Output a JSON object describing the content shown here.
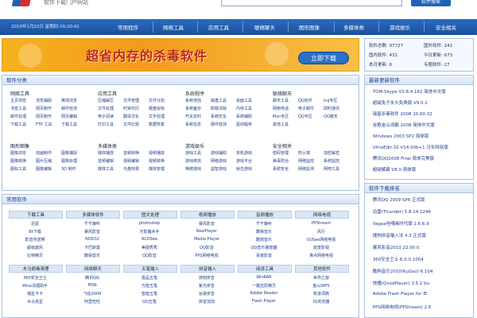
{
  "header": {
    "site_sub": "软件下载门户网站",
    "search_btn": "软件搜索"
  },
  "nav": {
    "date": "2010年1月22日 星期四 09:20:42",
    "items": [
      "常用程序",
      "网络工具",
      "应用工具",
      "联络聊天",
      "图形图像",
      "多媒体类",
      "游戏娱乐",
      "安全相关"
    ]
  },
  "banner": {
    "text": "超省内存的杀毒软件",
    "button": "立即下载"
  },
  "stats": {
    "line1a": "软件总数: 97727",
    "line1b": "国外软件: 241",
    "line2a": "国内软件: 431",
    "line2b": "今日更新: 673",
    "line3a": "本月更新: 6",
    "line3b": "专题软件: 27"
  },
  "categories": {
    "head": "软件分类",
    "groups": [
      {
        "title": "网络工具",
        "items": [
          "主页浏览",
          "浏览辅助",
          "离线浏览",
          "书签工具",
          "网页制作",
          "邮件检测",
          "邮件处理",
          "网页制作",
          "网页编辑",
          "下载工具",
          "FTP 工具",
          "下载工具"
        ]
      },
      {
        "title": "应用工具",
        "items": [
          "压缩解压",
          "文件管理",
          "文件分割",
          "文件处理",
          "时钟日历",
          "键盘鼠标",
          "电子阅读",
          "翻译汉化",
          "文字处理",
          "打印工具",
          "文件比较",
          "数据恢复"
        ]
      },
      {
        "title": "系统程序",
        "items": [
          "系统增强",
          "磁盘工具",
          "桌面工具",
          "系统备份",
          "卸载清除",
          "内存工具",
          "开关定时",
          "系统优化",
          "系统辅助",
          "系统信息",
          "硬件检测",
          "驱动程序"
        ]
      },
      {
        "title": "联络聊天",
        "items": [
          "聊天工具",
          "QQ软件",
          "Icq专区",
          "网络电话",
          "电子邮件",
          "即时通讯",
          "Msn专区",
          "QQ专区",
          "QQ聊天",
          "其他工具",
          "",
          ""
        ]
      },
      {
        "title": "图形图像",
        "items": [
          "图像浏览",
          "动画制作",
          "图像捕捉",
          "图像转换",
          "图片压缩",
          "图像处理",
          "图标工具",
          "图像编辑",
          "3D 制作"
        ]
      },
      {
        "title": "多媒体类",
        "items": [
          "媒体播放",
          "音频转换",
          "视频播放",
          "音频编辑",
          "视频编辑",
          "视频转换",
          "媒体工具",
          "光盘刻录",
          "媒体管理"
        ]
      },
      {
        "title": "游戏娱乐",
        "items": [
          "游戏工具",
          "游戏辅助",
          "单机游戏",
          "游戏修改",
          "网络游戏",
          "游戏平台",
          "棋牌游戏",
          "益智游戏",
          "射击游戏"
        ]
      },
      {
        "title": "安全相关",
        "items": [
          "密码管理",
          "防火墙",
          "加密解密",
          "病毒防治",
          "网络监控",
          "系统监控",
          "系统安全",
          "网络监测",
          "网吧工具"
        ]
      }
    ]
  },
  "common": {
    "head": "常用软件",
    "columns": [
      {
        "title": "下载工具",
        "items": [
          "迅雷",
          "Bt下载",
          "影音传送带",
          "超级旋风",
          "比特精灵"
        ]
      },
      {
        "title": "多媒体软件",
        "items": [
          "千千静听",
          "暴风影音",
          "NOD32",
          "卡巴斯基",
          "酷我音乐"
        ]
      },
      {
        "title": "图文处理",
        "items": [
          "photoshop",
          "光影魔术手",
          "ACDSee",
          "美图秀秀",
          "QQ影音"
        ]
      },
      {
        "title": "视频播放",
        "items": [
          "暴风影音",
          "RealPlayer",
          "Media Player",
          "QQ影音",
          "PPS网络电视"
        ]
      },
      {
        "title": "音频播放",
        "items": [
          "千千静听",
          "酷我音乐",
          "酷狗音乐",
          "QQ音乐播放器",
          "百度影音"
        ]
      },
      {
        "title": "网络电视",
        "items": [
          "PPStream",
          "风行",
          "UUSee网络电视",
          "皮皮影视",
          "沸点网络电视"
        ]
      }
    ],
    "columns2": [
      {
        "title": "木马病毒清理",
        "items": [
          "360安全卫士",
          "Wise清理助手",
          "瑞星卡卡",
          "木马克星"
        ]
      },
      {
        "title": "网络聊天",
        "items": [
          "腾讯QQ",
          "MSN",
          "飞信2009",
          "阿里旺旺"
        ]
      },
      {
        "title": "五笔输入",
        "items": [
          "极品五笔",
          "万能五笔",
          "智能五笔",
          "QQ五笔"
        ]
      },
      {
        "title": "拼音输入",
        "items": [
          "搜狗拼音",
          "紫光拼音",
          "谷歌拼音",
          "拼音加加"
        ]
      },
      {
        "title": "阅读工具",
        "items": [
          "WinRAR",
          "一键还原精灵",
          "Adobe Reader",
          "Flash Player"
        ]
      },
      {
        "title": "其他软件",
        "items": [
          "世界之窗",
          "金山WPS",
          "有道词典",
          "IQ浏览器"
        ]
      }
    ]
  },
  "latest": {
    "head": "最新更新软件",
    "items": [
      "TOM-Skype V3.8.4.182 简体中文版",
      "超级兔子永久免费版 V9.0.1",
      "瑞星杀毒软件 2008 20.60.32",
      "谷歌金山词霸 2008 简体中文版",
      "Windows 2003 SP2 简体版",
      "UltraEdit-32 V14.00b+1 汉化特别版",
      "腾讯QQ2008 Final 简体完美版",
      "超级解霸 V8.0 简体版"
    ]
  },
  "ranking": {
    "head": "软件下载排名",
    "items": [
      "腾讯QQ 2009 SP6 正式版",
      "迅雷(Thunder) 5.8.14.1246",
      "Vagaa哇嘎画时代版 2.6.6.9",
      "搜狗拼音输入法 4.3 正式版",
      "暴风影音2010 22.00.0",
      "360安全卫士 6.0.0.1004",
      "酷狗音乐2010(KuGoo) 6.104",
      "快播(QvodPlayer) 3.5.1 bu",
      "Adobe Flash Player for IE",
      "PPS网络电视(PPStream) 2.6"
    ]
  }
}
